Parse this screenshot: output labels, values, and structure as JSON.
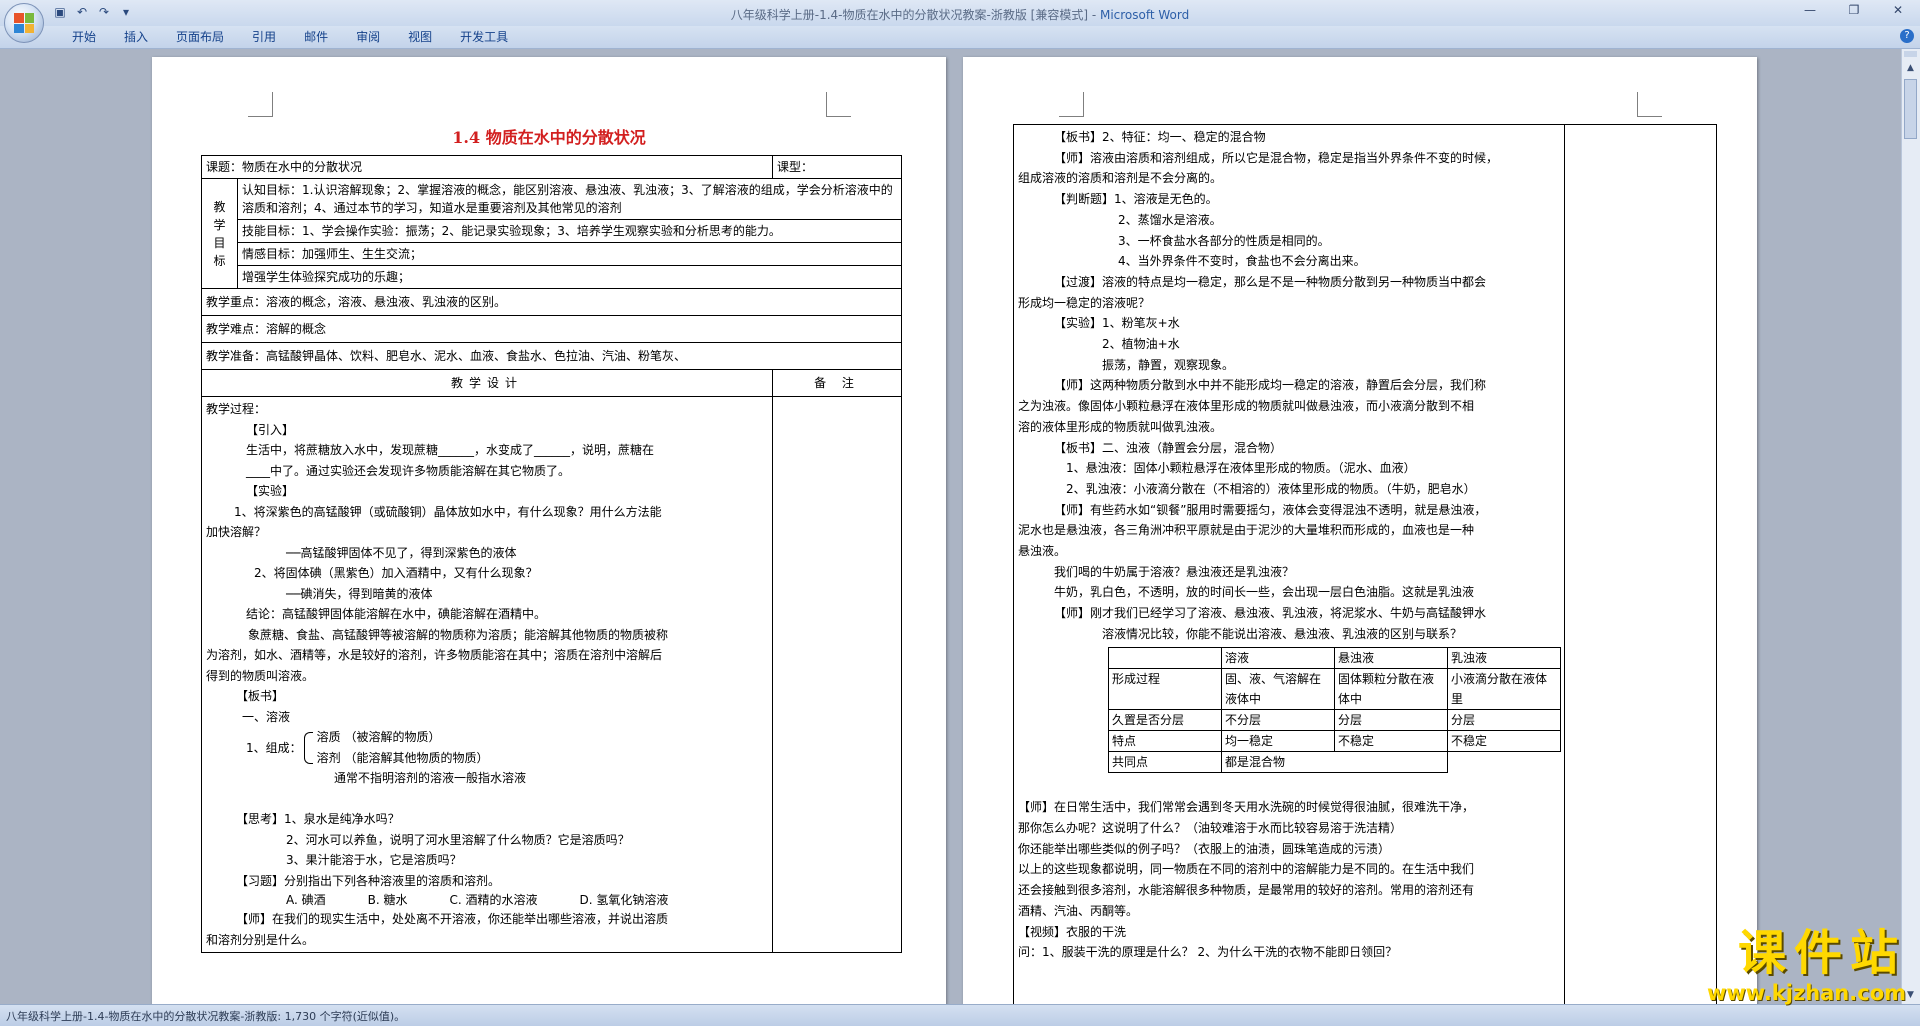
{
  "window": {
    "title_doc": "八年级科学上册-1.4-物质在水中的分散状况教案-浙教版 [兼容模式] - ",
    "title_app": "Microsoft Word"
  },
  "ribbon": {
    "tabs": [
      "开始",
      "插入",
      "页面布局",
      "引用",
      "邮件",
      "审阅",
      "视图",
      "开发工具"
    ]
  },
  "page1": {
    "title": "1.4  物质在水中的分散状况",
    "lesson_label": "课题：物质在水中的分散状况",
    "type_label": "课型：",
    "goals_vertical": [
      "教",
      "学",
      "目",
      "标"
    ],
    "goal_cognitive": "认知目标：1.认识溶解现象；2、掌握溶液的概念，能区别溶液、悬浊液、乳浊液；3、了解溶液的组成，学会分析溶液中的溶质和溶剂；4、通过本节的学习，知道水是重要溶剂及其他常见的溶剂",
    "goal_skill": "技能目标：1、学会操作实验：振荡；2、能记录实验现象；3、培养学生观察实验和分析思考的能力。",
    "goal_emotion": "情感目标：加强师生、生生交流；",
    "goal_emotion2": "增强学生体验探究成功的乐趣；",
    "key_points": "教学重点：溶液的概念，溶液、悬浊液、乳浊液的区别。",
    "difficulty": "教学难点：溶解的概念",
    "preparation": "教学准备：高锰酸钾晶体、饮料、肥皂水、泥水、血液、食盐水、色拉油、汽油、粉笔灰、",
    "design_header": "教学设计",
    "notes_header": "备  注",
    "process": {
      "l01": "教学过程：",
      "l02": "【引入】",
      "l03": "生活中，将蔗糖放入水中，发现蔗糖______，水变成了______，说明，蔗糖在",
      "l04": "____中了。通过实验还会发现许多物质能溶解在其它物质了。",
      "l05": "【实验】",
      "l06": "1、将深紫色的高锰酸钾（或硫酸铜）晶体放如水中，有什么现象？用什么方法能",
      "l07": "加快溶解？",
      "l08": "──高锰酸钾固体不见了，得到深紫色的液体",
      "l09": "2、将固体碘（黑紫色）加入酒精中，又有什么现象？",
      "l10": "──碘消失，得到暗黄的液体",
      "l11": "结论：高锰酸钾固体能溶解在水中，碘能溶解在酒精中。",
      "l12": "象蔗糖、食盐、高锰酸钾等被溶解的物质称为溶质；能溶解其他物质的物质被称",
      "l13": "为溶剂，如水、酒精等，水是较好的溶剂，许多物质能溶在其中；溶质在溶剂中溶解后",
      "l14": "得到的物质叫溶液。",
      "l15": "【板书】",
      "l16": "一、溶液",
      "l17": "1、组成：",
      "l18": "溶质  （被溶解的物质）",
      "l19": "溶剂  （能溶解其他物质的物质）",
      "l20": "通常不指明溶剂的溶液一般指水溶液",
      "l21": "【思考】1、泉水是纯净水吗？",
      "l22": "2、河水可以养鱼，说明了河水里溶解了什么物质？它是溶质吗？",
      "l23": "3、果汁能溶于水，它是溶质吗？",
      "l24": "【习题】分别指出下列各种溶液里的溶质和溶剂。",
      "opts": [
        "A. 碘酒",
        "B. 糖水",
        "C. 酒精的水溶液",
        "D. 氢氧化钠溶液"
      ],
      "l25": "【师】在我们的现实生活中，处处离不开溶液，你还能举出哪些溶液，并说出溶质",
      "l26": "和溶剂分别是什么。"
    }
  },
  "page2": {
    "lines_a": [
      "【板书】2、特征：均一、稳定的混合物",
      "【师】溶液由溶质和溶剂组成，所以它是混合物，稳定是指当外界条件不变的时候，",
      "组成溶液的溶质和溶剂是不会分离的。",
      "【判断题】1、溶液是无色的。",
      "2、蒸馏水是溶液。",
      "3、一杯食盐水各部分的性质是相同的。",
      "4、当外界条件不变时，食盐也不会分离出来。",
      "【过渡】溶液的特点是均一稳定，那么是不是一种物质分散到另一种物质当中都会",
      "形成均一稳定的溶液呢？",
      "【实验】1、粉笔灰+水",
      "2、植物油+水",
      "振荡，静置，观察现象。",
      "【师】这两种物质分散到水中并不能形成均一稳定的溶液，静置后会分层，我们称",
      "之为浊液。像固体小颗粒悬浮在液体里形成的物质就叫做悬浊液，而小液滴分散到不相",
      "溶的液体里形成的物质就叫做乳浊液。",
      "【板书】二、浊液（静置会分层，混合物）",
      "1、悬浊液：固体小颗粒悬浮在液体里形成的物质。（泥水、血液）",
      "2、乳浊液：小液滴分散在（不相溶的）液体里形成的物质。（牛奶，肥皂水）",
      "【师】有些药水如“钡餐”服用时需要摇匀，液体会变得混浊不透明，就是悬浊液，",
      "泥水也是悬浊液，各三角洲冲积平原就是由于泥沙的大量堆积而形成的，血液也是一种",
      "悬浊液。",
      "我们喝的牛奶属于溶液？悬浊液还是乳浊液？",
      "牛奶，乳白色，不透明，放的时间长一些，会出现一层白色油脂。这就是乳浊液",
      "【师】刚才我们已经学习了溶液、悬浊液、乳浊液，将泥浆水、牛奶与高锰酸钾水",
      "溶液情况比较，你能不能说出溶液、悬浊液、乳浊液的区别与联系？"
    ],
    "compare_table": {
      "headers": [
        "",
        "溶液",
        "悬浊液",
        "乳浊液"
      ],
      "rows": [
        [
          "形成过程",
          "固、液、气溶解在液体中",
          "固体颗粒分散在液体中",
          "小液滴分散在液体里"
        ],
        [
          "久置是否分层",
          "不分层",
          "分层",
          "分层"
        ],
        [
          "特点",
          "均一稳定",
          "不稳定",
          "不稳定"
        ],
        [
          "共同点",
          "都是混合物",
          "",
          ""
        ]
      ]
    },
    "lines_b": [
      "【师】在日常生活中，我们常常会遇到冬天用水洗碗的时候觉得很油腻，很难洗干净，",
      "那你怎么办呢？这说明了什么？（油较难溶于水而比较容易溶于洗洁精）",
      "你还能举出哪些类似的例子吗？（衣服上的油渍，圆珠笔造成的污渍）",
      "以上的这些现象都说明，同一物质在不同的溶剂中的溶解能力是不同的。在生活中我们",
      "还会接触到很多溶剂，水能溶解很多种物质，是最常用的较好的溶剂。常用的溶剂还有",
      "酒精、汽油、丙酮等。",
      "【视频】衣服的干洗",
      "问：1、服装干洗的原理是什么？  2、为什么干洗的衣物不能即日领回？"
    ]
  },
  "status": {
    "text": "八年级科学上册-1.4-物质在水中的分散状况教案-浙教版: 1,730 个字符(近似值)。"
  },
  "watermark": {
    "title": "课件站",
    "url": "www.kjzhan.com"
  },
  "colors": {
    "title_red": "#d21f1f",
    "ribbon_text": "#15428b",
    "watermark": "#ffd800"
  }
}
